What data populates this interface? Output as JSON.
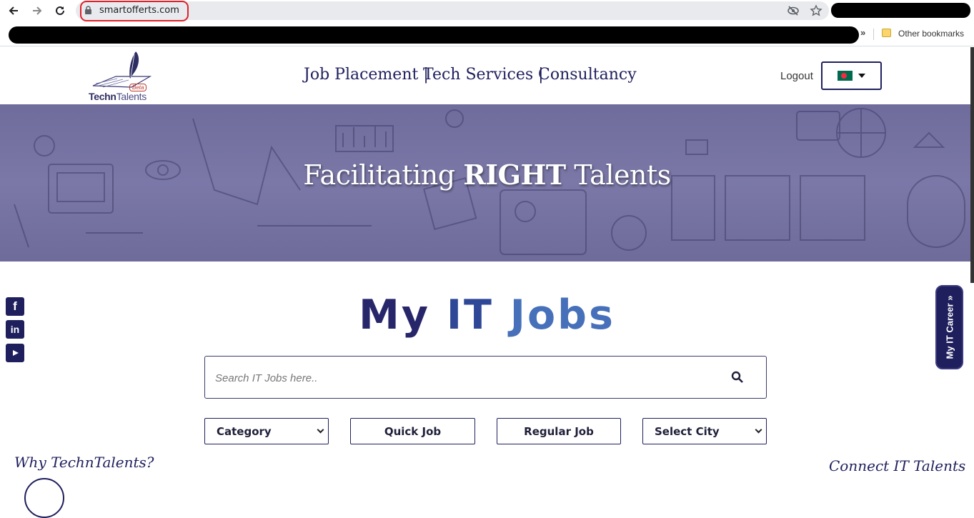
{
  "browser": {
    "url": "smartofferts.com",
    "other_bookmarks": "Other bookmarks",
    "chevron": "»"
  },
  "header": {
    "logo_main": "Techn",
    "logo_accent": "Talents",
    "logo_beta": "Beta",
    "nav": [
      "Job Placement |",
      "Tech Services |",
      "Consultancy"
    ],
    "logout": "Logout",
    "language_flag": "bangladesh-flag-icon"
  },
  "hero": {
    "title_pre": "Facilitating ",
    "title_bold": "RIGHT",
    "title_post": " Talents"
  },
  "social": [
    "facebook-icon",
    "linkedin-icon",
    "youtube-icon"
  ],
  "main": {
    "heading_my": "My",
    "heading_it": "IT",
    "heading_jobs": "Jobs",
    "search_placeholder": "Search IT Jobs here..",
    "category_select": "Category",
    "quick_job": "Quick Job",
    "regular_job": "Regular Job",
    "city_select": "Select City"
  },
  "side_tab": {
    "label": "My IT Career »"
  },
  "footer_sections": {
    "why": "Why TechnTalents?",
    "connect": "Connect IT Talents"
  },
  "colors": {
    "brand_navy": "#1f1f5e",
    "heading_blue": "#4670b9",
    "hero_purple": "#75729f",
    "url_highlight": "#e0202a"
  }
}
